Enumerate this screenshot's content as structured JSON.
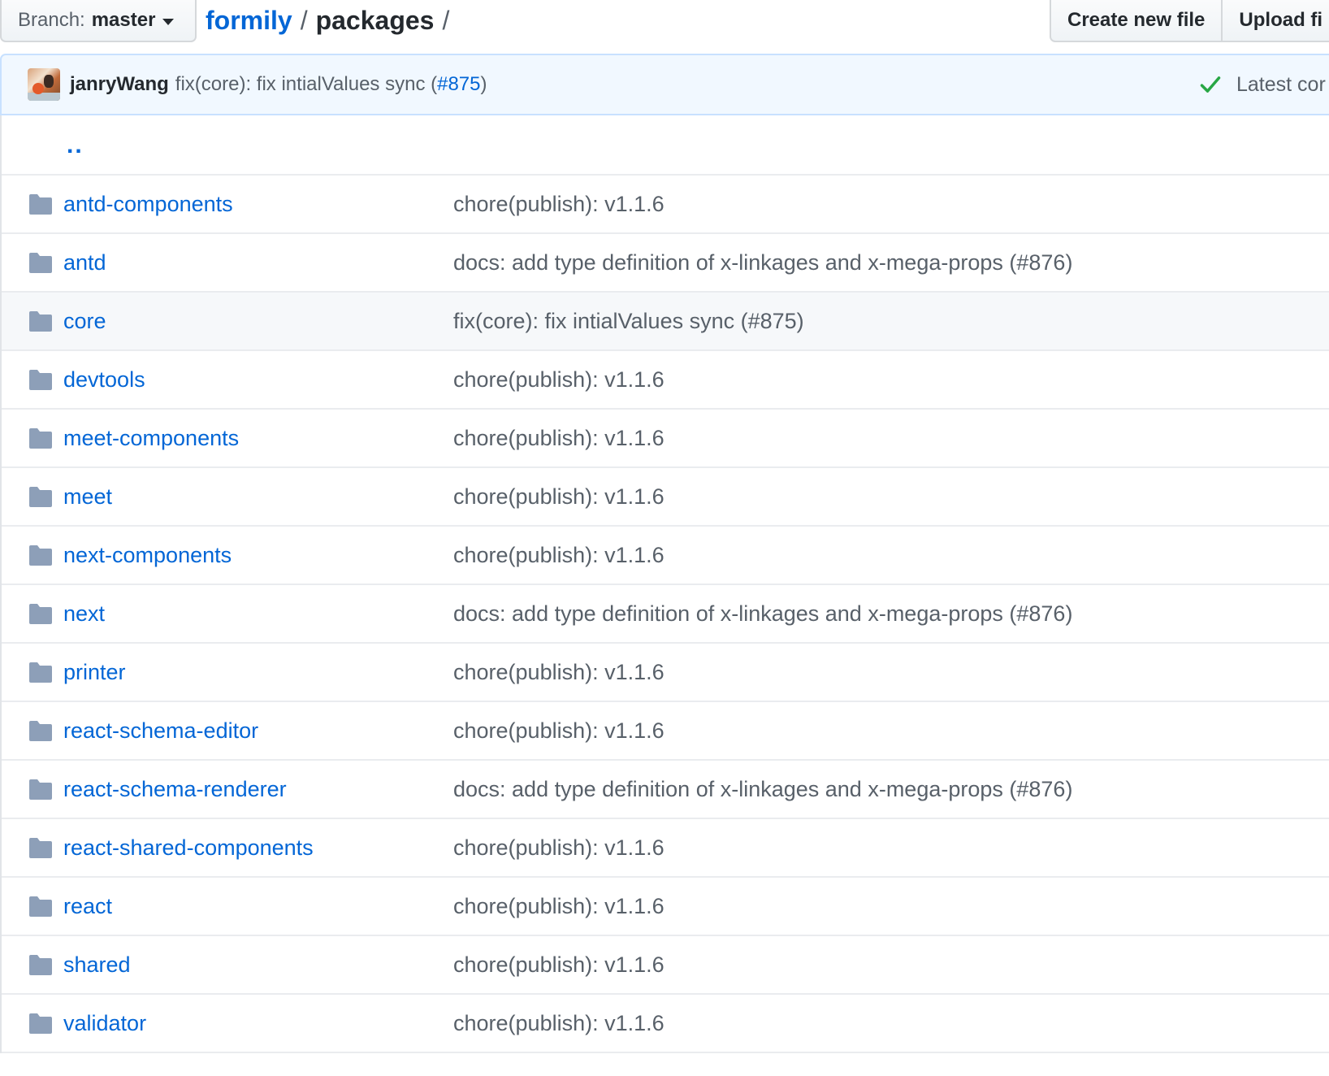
{
  "branch": {
    "label": "Branch:",
    "value": "master"
  },
  "breadcrumb": {
    "repo": "formily",
    "separator": "/",
    "directory": "packages",
    "trailing": "/"
  },
  "actions": {
    "create_label": "Create new file",
    "upload_label": "Upload fi"
  },
  "commit": {
    "author": "janryWang",
    "message_prefix": "fix(core): fix intialValues sync (",
    "pr": "#875",
    "message_suffix": ")",
    "latest_label": "Latest cor"
  },
  "parent_link": "..",
  "colors": {
    "link": "#0366d6",
    "folder": "#79b8ff",
    "check": "#28a745",
    "commit_bar_bg": "#f1f8ff"
  },
  "files": [
    {
      "name": "antd-components",
      "message": "chore(publish): v1.1.6"
    },
    {
      "name": "antd",
      "message": "docs: add type definition of x-linkages and x-mega-props (#876)"
    },
    {
      "name": "core",
      "message": "fix(core): fix intialValues sync (#875)"
    },
    {
      "name": "devtools",
      "message": "chore(publish): v1.1.6"
    },
    {
      "name": "meet-components",
      "message": "chore(publish): v1.1.6"
    },
    {
      "name": "meet",
      "message": "chore(publish): v1.1.6"
    },
    {
      "name": "next-components",
      "message": "chore(publish): v1.1.6"
    },
    {
      "name": "next",
      "message": "docs: add type definition of x-linkages and x-mega-props (#876)"
    },
    {
      "name": "printer",
      "message": "chore(publish): v1.1.6"
    },
    {
      "name": "react-schema-editor",
      "message": "chore(publish): v1.1.6"
    },
    {
      "name": "react-schema-renderer",
      "message": "docs: add type definition of x-linkages and x-mega-props (#876)"
    },
    {
      "name": "react-shared-components",
      "message": "chore(publish): v1.1.6"
    },
    {
      "name": "react",
      "message": "chore(publish): v1.1.6"
    },
    {
      "name": "shared",
      "message": "chore(publish): v1.1.6"
    },
    {
      "name": "validator",
      "message": "chore(publish): v1.1.6"
    }
  ]
}
